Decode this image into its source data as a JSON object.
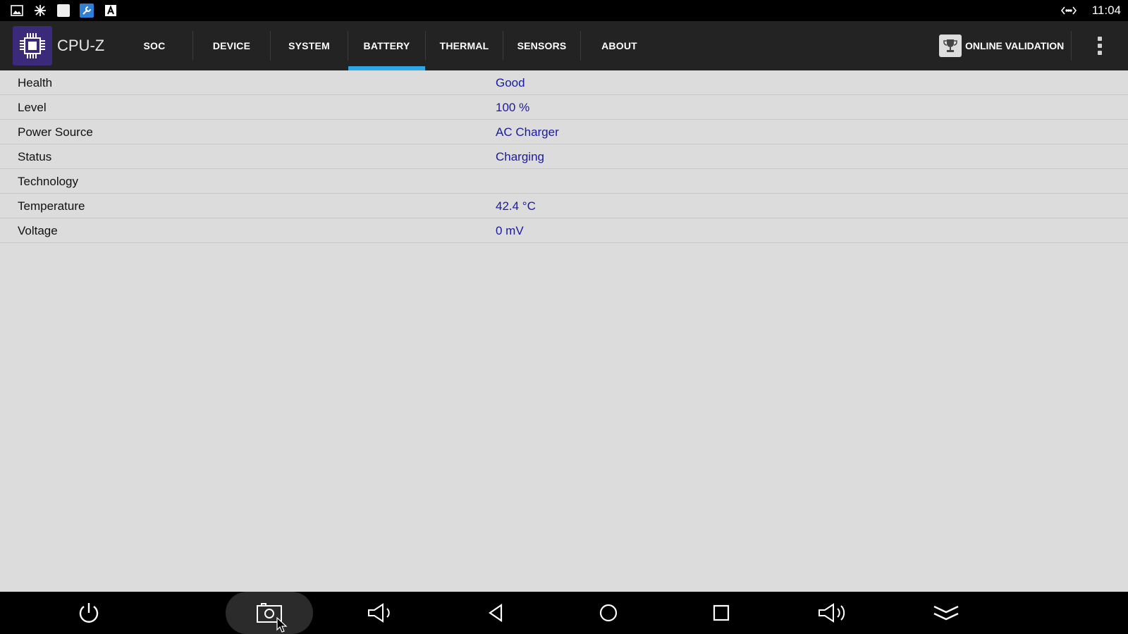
{
  "status_bar": {
    "clock": "11:04",
    "icons": [
      "gallery-icon",
      "snowflake-icon",
      "blank-app-icon",
      "wrench-icon",
      "font-icon"
    ],
    "network_icon": "code-arrows-icon"
  },
  "app": {
    "title": "CPU-Z",
    "logo_icon": "chip-icon",
    "accent_color": "#2ea8e5"
  },
  "tabs": [
    {
      "label": "SOC"
    },
    {
      "label": "DEVICE"
    },
    {
      "label": "SYSTEM"
    },
    {
      "label": "BATTERY",
      "active": true
    },
    {
      "label": "THERMAL"
    },
    {
      "label": "SENSORS"
    },
    {
      "label": "ABOUT"
    }
  ],
  "toolbar": {
    "validation_label": "ONLINE VALIDATION",
    "validation_icon": "trophy-icon",
    "overflow_icon": "more-vert-icon"
  },
  "battery": {
    "rows": [
      {
        "label": "Health",
        "value": "Good"
      },
      {
        "label": "Level",
        "value": "100 %"
      },
      {
        "label": "Power Source",
        "value": "AC Charger"
      },
      {
        "label": "Status",
        "value": "Charging"
      },
      {
        "label": "Technology",
        "value": ""
      },
      {
        "label": "Temperature",
        "value": "42.4 °C"
      },
      {
        "label": "Voltage",
        "value": "0 mV"
      }
    ]
  },
  "nav_bar": {
    "buttons": [
      "power-icon",
      "screenshot-icon",
      "volume-down-icon",
      "back-icon",
      "home-icon",
      "recents-icon",
      "volume-up-icon",
      "collapse-icon"
    ]
  }
}
